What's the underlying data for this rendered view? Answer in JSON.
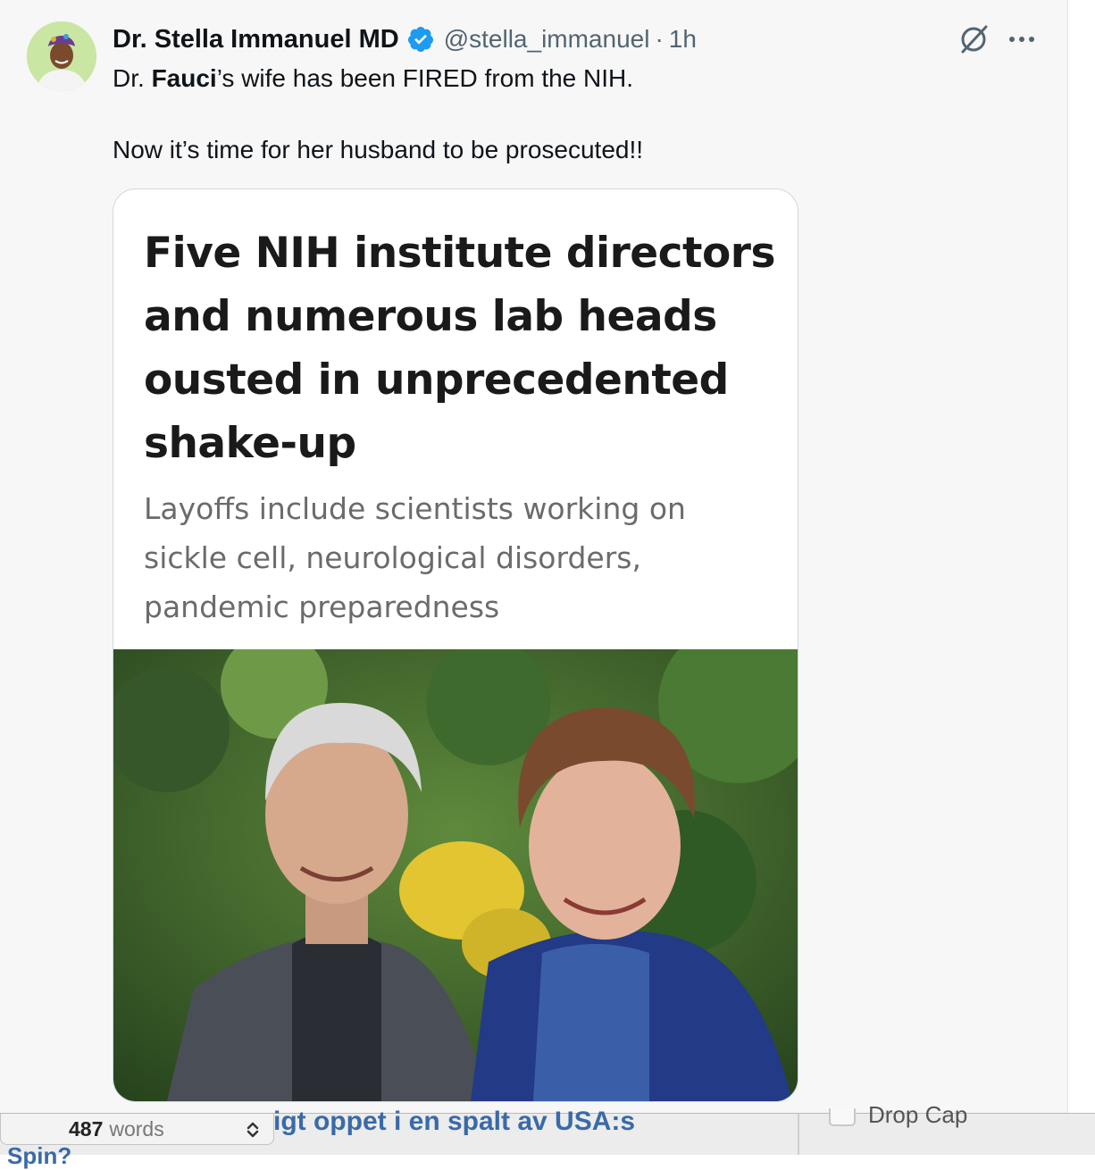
{
  "tweet": {
    "author": {
      "display_name": "Dr. Stella Immanuel MD",
      "handle": "@stella_immanuel",
      "verified": true,
      "avatar_icon": "user-avatar"
    },
    "separator": "·",
    "time": "1h",
    "text": {
      "line1_prefix": "Dr. ",
      "line1_bold": "Fauci",
      "line1_suffix": "’s wife has been FIRED from the NIH.",
      "line2": "Now it’s time for her husband to be prosecuted!!"
    },
    "actions": {
      "grok_icon": "grok-icon",
      "more_icon": "more-horizontal-icon"
    },
    "card": {
      "headline": "Five NIH institute directors and numerous lab heads ousted in unprecedented shake-up",
      "subhead": "Layoffs include scientists working on sickle cell, neurological disorders, pandemic preparedness",
      "photo_icon": "photo-two-people"
    }
  },
  "editor_bar": {
    "word_count": "487",
    "word_label": "words",
    "stepper_icon": "stepper-icon",
    "doc_text": "igt oppet i en spalt av USA:s",
    "doc_text_line2": "Spin?",
    "drop_cap_label": "Drop Cap"
  },
  "colors": {
    "verified": "#1d9bf0",
    "text_primary": "#0f1419",
    "text_secondary": "#536471",
    "doc_link": "#3a6aa8"
  }
}
